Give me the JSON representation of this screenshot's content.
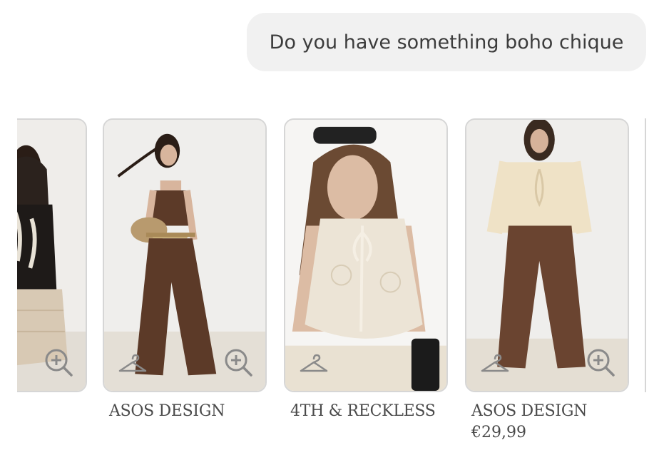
{
  "chat": {
    "user_message": "Do you have something boho chique"
  },
  "products": [
    {
      "brand": "",
      "price": "",
      "photo": "partial-crochet-outfit-photo"
    },
    {
      "brand": "ASOS DESIGN",
      "price": "",
      "photo": "brown-bandeau-trousers-photo"
    },
    {
      "brand": "4TH & RECKLESS",
      "price": "",
      "photo": "crochet-tie-top-photo"
    },
    {
      "brand": "ASOS DESIGN",
      "price": "€29,99",
      "photo": "cream-blouse-brown-trousers-photo"
    }
  ],
  "icons": {
    "zoom": "zoom-in-icon",
    "hanger": "hanger-icon"
  },
  "colors": {
    "bubble_bg": "#f1f1f1",
    "card_border": "#d6d6d6",
    "text": "#4a4a4a"
  }
}
